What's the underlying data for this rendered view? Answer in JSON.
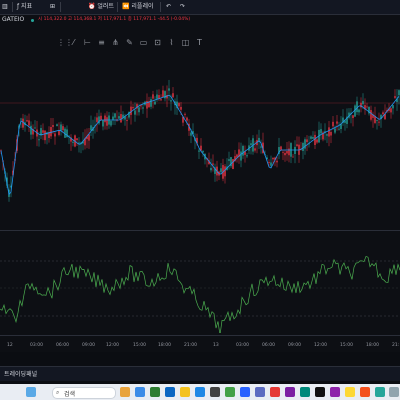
{
  "toolbar": {
    "indicators_label": "지표",
    "alerts_label": "얼러트",
    "replay_label": "리플레이"
  },
  "legend": {
    "exchange": "GATEIO",
    "ohlc_text": "시 114,322.0  고 114,368.1  저 117,971.1  종 117,971.1 -44.5 (-0.04%)"
  },
  "time_axis": {
    "labels": [
      "12",
      "03:00",
      "06:00",
      "09:00",
      "12:00",
      "15:00",
      "18:00",
      "21:00",
      "13",
      "03:00",
      "06:00",
      "09:00",
      "12:00",
      "15:00",
      "18:00",
      "21:"
    ]
  },
  "bottom_panel": {
    "tab_label": "트레이딩패널"
  },
  "taskbar": {
    "search_placeholder": "검색"
  },
  "colors": {
    "up": "#26a69a",
    "down": "#f23645",
    "ma": "#2196f3",
    "oscillator": "#4caf50",
    "background": "#0d0f14"
  },
  "icons": [
    "chart-type-icon",
    "indicators-icon",
    "alert-icon",
    "replay-icon",
    "undo-icon",
    "redo-icon",
    "trend-line-icon",
    "cross-line-icon",
    "pitchfork-icon",
    "brush-icon",
    "rectangle-icon",
    "measure-icon",
    "text-icon",
    "search-icon"
  ]
}
